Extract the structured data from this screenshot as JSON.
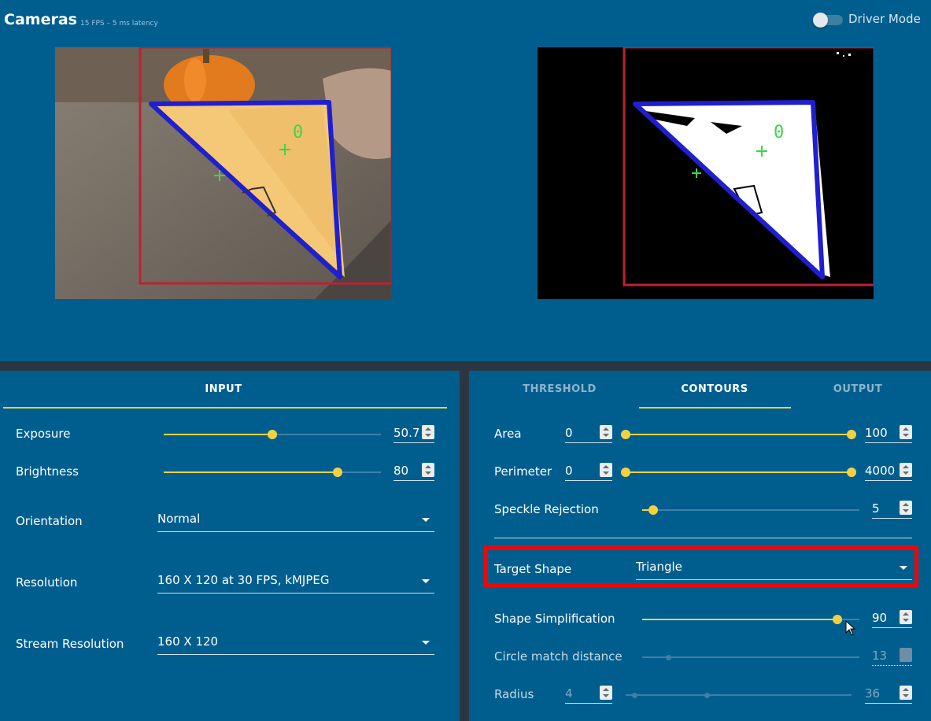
{
  "header": {
    "title": "Cameras",
    "stats": "15 FPS – 5 ms latency",
    "driver_mode_label": "Driver Mode",
    "driver_mode_on": false
  },
  "cameras": {
    "overlay_label": "0",
    "colors": {
      "contour": "#1f1fd0",
      "bounding": "#c0202a",
      "marker": "#3ed64a"
    }
  },
  "input_panel": {
    "tab": "INPUT",
    "exposure": {
      "label": "Exposure",
      "value": "50.7",
      "fraction": 0.5
    },
    "brightness": {
      "label": "Brightness",
      "value": "80",
      "fraction": 0.8
    },
    "orientation": {
      "label": "Orientation",
      "value": "Normal"
    },
    "resolution": {
      "label": "Resolution",
      "value": "160 X 120 at 30 FPS, kMJPEG"
    },
    "stream_resolution": {
      "label": "Stream Resolution",
      "value": "160 X 120"
    }
  },
  "pipeline_panel": {
    "tabs": [
      "THRESHOLD",
      "CONTOURS",
      "OUTPUT"
    ],
    "active_tab": "CONTOURS",
    "area": {
      "label": "Area",
      "min": "0",
      "max": "100"
    },
    "perimeter": {
      "label": "Perimeter",
      "min": "0",
      "max": "4000"
    },
    "speckle": {
      "label": "Speckle Rejection",
      "value": "5",
      "fraction": 0.05
    },
    "target_shape": {
      "label": "Target Shape",
      "value": "Triangle"
    },
    "shape_simplification": {
      "label": "Shape Simplification",
      "value": "90",
      "fraction": 0.9
    },
    "circle_match": {
      "label": "Circle match distance",
      "value": "13",
      "fraction": 0.12
    },
    "radius": {
      "label": "Radius",
      "min": "4",
      "max": "36"
    }
  },
  "colors": {
    "background": "#005e8f",
    "accent": "#f3d142",
    "highlight": "#ff0000",
    "separator": "#2b3640"
  }
}
